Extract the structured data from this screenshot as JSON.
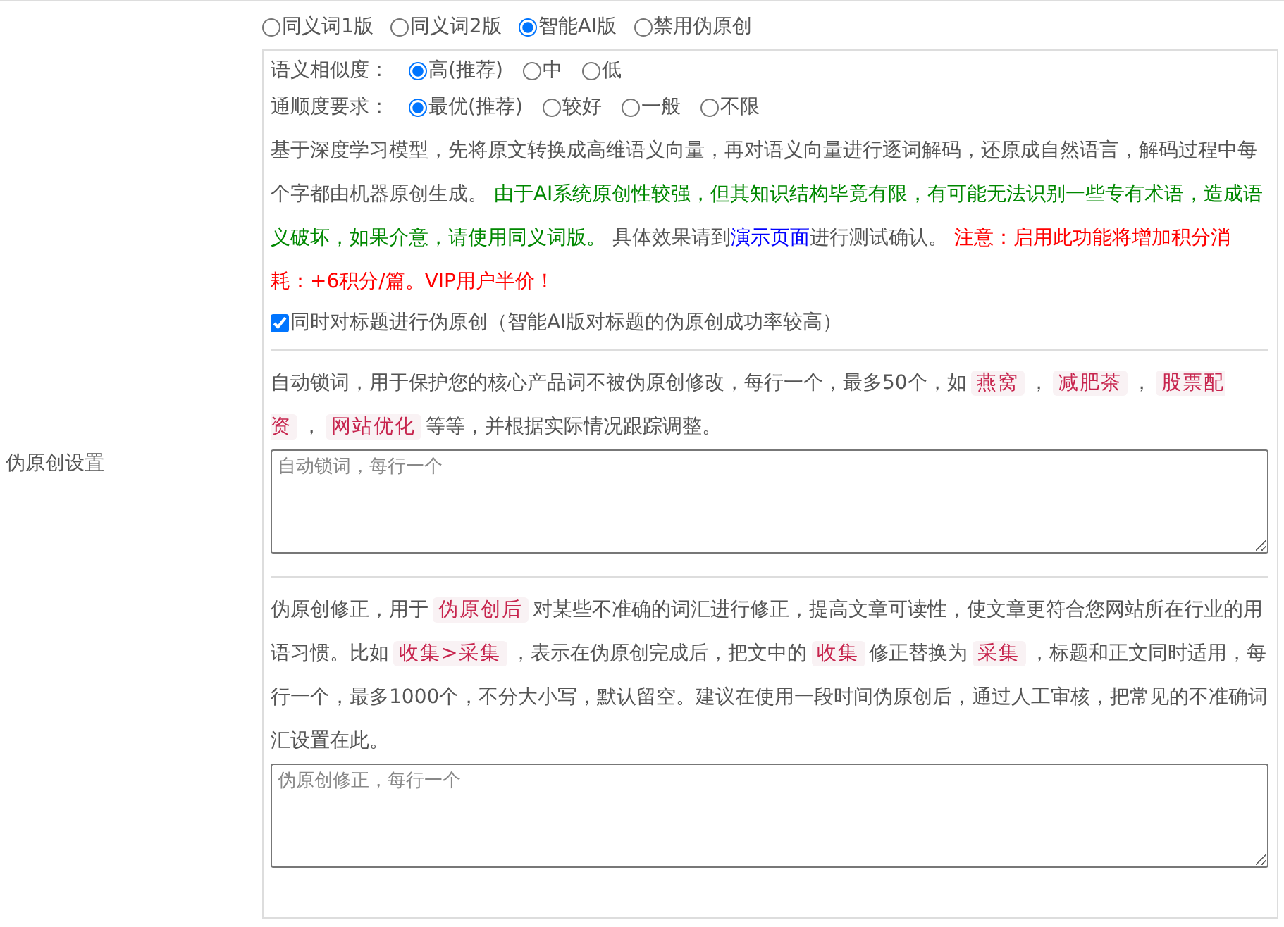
{
  "side_label": "伪原创设置",
  "mode_options": [
    {
      "label": "同义词1版",
      "selected": false
    },
    {
      "label": "同义词2版",
      "selected": false
    },
    {
      "label": "智能AI版",
      "selected": true
    },
    {
      "label": "禁用伪原创",
      "selected": false
    }
  ],
  "similarity": {
    "label": "语义相似度：",
    "options": [
      {
        "label": "高(推荐)",
        "selected": true
      },
      {
        "label": "中",
        "selected": false
      },
      {
        "label": "低",
        "selected": false
      }
    ]
  },
  "fluency": {
    "label": "通顺度要求：",
    "options": [
      {
        "label": "最优(推荐)",
        "selected": true
      },
      {
        "label": "较好",
        "selected": false
      },
      {
        "label": "一般",
        "selected": false
      },
      {
        "label": "不限",
        "selected": false
      }
    ]
  },
  "ai_description": [
    {
      "kind": "plain",
      "text": "基于深度学习模型，先将原文转换成高维语义向量，再对语义向量进行逐词解码，还原成自然语言，解码过程中每个字都由机器原创生成。 "
    },
    {
      "kind": "green",
      "text": "由于AI系统原创性较强，但其知识结构毕竟有限，有可能无法识别一些专有术语，造成语义破坏，如果介意，请使用同义词版。"
    },
    {
      "kind": "plain",
      "text": " 具体效果请到"
    },
    {
      "kind": "link",
      "text": "演示页面"
    },
    {
      "kind": "plain",
      "text": "进行测试确认。 "
    },
    {
      "kind": "red",
      "text": "注意：启用此功能将增加积分消耗：+6积分/篇。VIP用户半价！"
    }
  ],
  "title_checkbox": {
    "label": "同时对标题进行伪原创（智能AI版对标题的伪原创成功率较高）",
    "checked": true
  },
  "lock_words": {
    "description": [
      {
        "kind": "plain",
        "text": "自动锁词，用于保护您的核心产品词不被伪原创修改，每行一个，最多50个，如"
      },
      {
        "kind": "code",
        "text": "燕窝"
      },
      {
        "kind": "plain",
        "text": "，"
      },
      {
        "kind": "code",
        "text": "减肥茶"
      },
      {
        "kind": "plain",
        "text": "，"
      },
      {
        "kind": "code",
        "text": "股票配资"
      },
      {
        "kind": "plain",
        "text": "，"
      },
      {
        "kind": "code",
        "text": "网站优化"
      },
      {
        "kind": "plain",
        "text": "等等，并根据实际情况跟踪调整。"
      }
    ],
    "placeholder": "自动锁词，每行一个"
  },
  "correction": {
    "description": [
      {
        "kind": "plain",
        "text": "伪原创修正，用于"
      },
      {
        "kind": "code",
        "text": "伪原创后"
      },
      {
        "kind": "plain",
        "text": "对某些不准确的词汇进行修正，提高文章可读性，使文章更符合您网站所在行业的用语习惯。比如"
      },
      {
        "kind": "code",
        "text": "收集>采集"
      },
      {
        "kind": "plain",
        "text": "，表示在伪原创完成后，把文中的"
      },
      {
        "kind": "code",
        "text": "收集"
      },
      {
        "kind": "plain",
        "text": "修正替换为"
      },
      {
        "kind": "code",
        "text": "采集"
      },
      {
        "kind": "plain",
        "text": "，标题和正文同时适用，每行一个，最多1000个，不分大小写，默认留空。建议在使用一段时间伪原创后，通过人工审核，把常见的不准确词汇设置在此。"
      }
    ],
    "placeholder": "伪原创修正，每行一个"
  }
}
